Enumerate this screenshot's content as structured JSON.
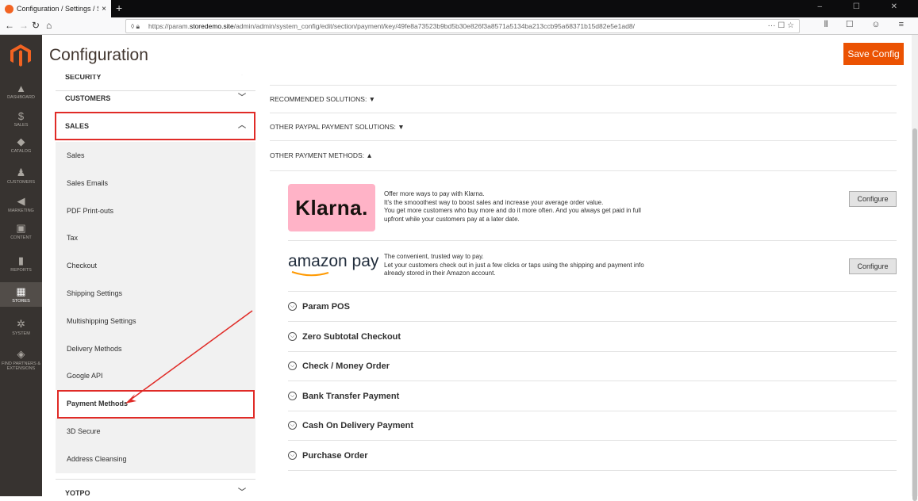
{
  "browser": {
    "tab_title": "Configuration / Settings / Store",
    "tab_close": "×",
    "new_tab": "+",
    "url_prefix": "https://param.",
    "url_domain": "storedemo.site",
    "url_rest": "/admin/admin/system_config/edit/section/payment/key/49fe8a73523b9bd5b30e826f3a8571a5134ba213ccb95a68371b15d82e5e1ad8/",
    "url_icons": "··· ☐ ☆",
    "window_controls": "– ☐ ✕",
    "toolbar_icons": "⫴ ☐ ☺ ≡"
  },
  "sidenav": {
    "items": [
      {
        "label": "DASHBOARD",
        "icon": "▲"
      },
      {
        "label": "SALES",
        "icon": "$"
      },
      {
        "label": "CATALOG",
        "icon": "◆"
      },
      {
        "label": "CUSTOMERS",
        "icon": "♟"
      },
      {
        "label": "MARKETING",
        "icon": "◀"
      },
      {
        "label": "CONTENT",
        "icon": "▣"
      },
      {
        "label": "REPORTS",
        "icon": "▮"
      },
      {
        "label": "STORES",
        "icon": "▦"
      },
      {
        "label": "SYSTEM",
        "icon": "✲"
      },
      {
        "label": "FIND PARTNERS & EXTENSIONS",
        "icon": "◈"
      }
    ],
    "active": "STORES"
  },
  "header": {
    "title": "Configuration",
    "save_label": "Save Config"
  },
  "left": {
    "security": "SECURITY",
    "customers": "CUSTOMERS",
    "sales": "SALES",
    "sales_items": [
      "Sales",
      "Sales Emails",
      "PDF Print-outs",
      "Tax",
      "Checkout",
      "Shipping Settings",
      "Multishipping Settings",
      "Delivery Methods",
      "Google API",
      "Payment Methods",
      "3D Secure",
      "Address Cleansing"
    ],
    "yotpo": "YOTPO"
  },
  "content": {
    "recommended": "RECOMMENDED SOLUTIONS: ▼",
    "other_paypal": "OTHER PAYPAL PAYMENT SOLUTIONS: ▼",
    "other_methods": "OTHER PAYMENT METHODS: ▲",
    "klarna": {
      "logo": "Klarna.",
      "line1": "Offer more ways to pay with Klarna.",
      "line2": "It's the smooothest way to boost sales and increase your average order value.",
      "line3": "You get more customers who buy more and do it more often. And you always get paid in full",
      "line4": "upfront while your customers pay at a later date.",
      "button": "Configure"
    },
    "amazon": {
      "logo": "amazon pay",
      "line1": "The convenient, trusted way to pay.",
      "line2": "Let your customers check out in just a few clicks or taps using the shipping and payment info",
      "line3": "already stored in their Amazon account.",
      "button": "Configure"
    },
    "sections": [
      "Param POS",
      "Zero Subtotal Checkout",
      "Check / Money Order",
      "Bank Transfer Payment",
      "Cash On Delivery Payment",
      "Purchase Order"
    ],
    "collapse_icon": "⌵"
  },
  "colors": {
    "accent": "#eb5202",
    "nav_bg": "#373330",
    "highlight": "#e02b27"
  }
}
